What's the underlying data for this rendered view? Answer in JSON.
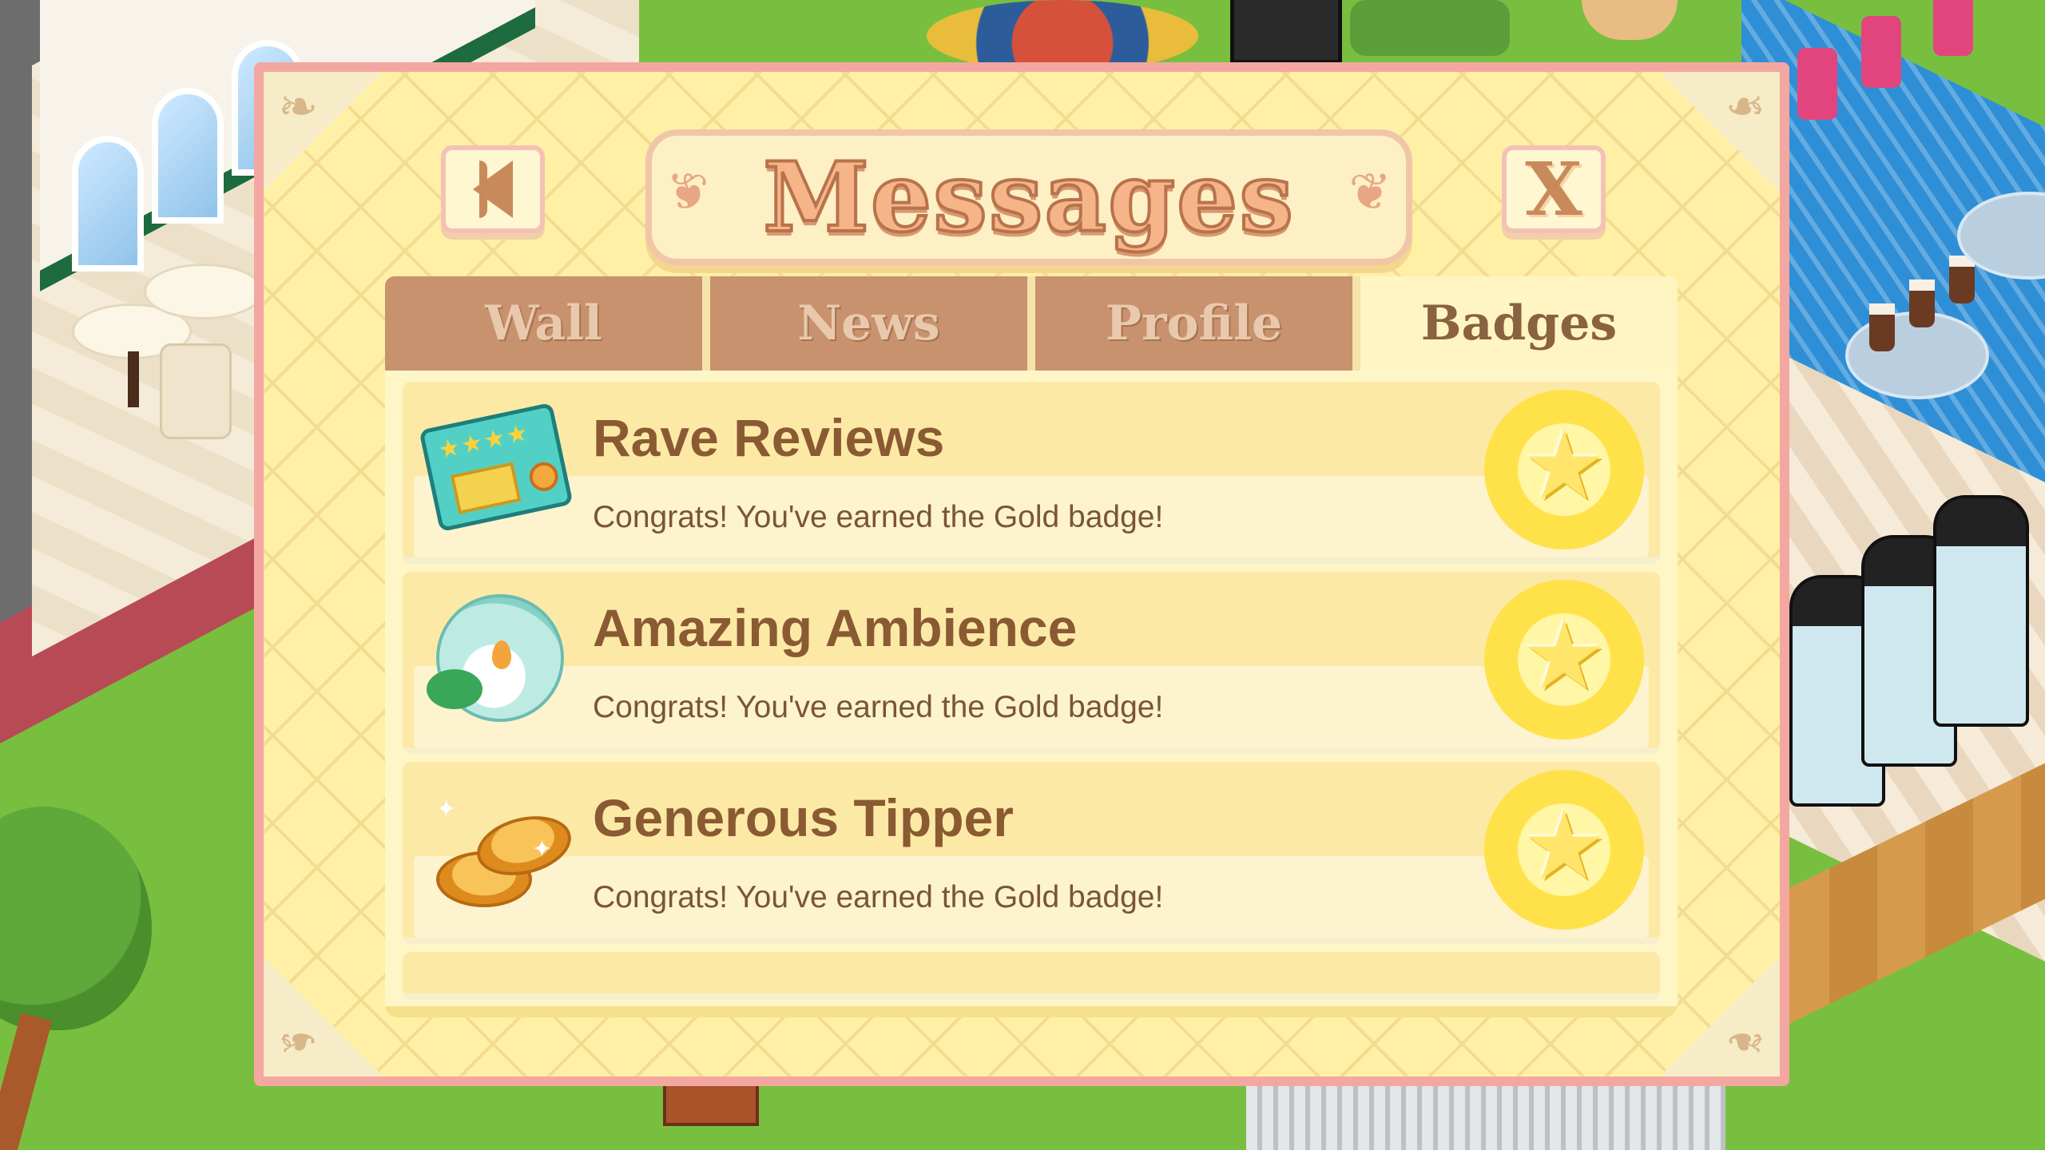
{
  "dialog": {
    "title": "Messages",
    "back_icon": "back-arrow-icon",
    "close_label": "X"
  },
  "tabs": [
    {
      "label": "Wall",
      "active": false
    },
    {
      "label": "News",
      "active": false
    },
    {
      "label": "Profile",
      "active": false
    },
    {
      "label": "Badges",
      "active": true
    }
  ],
  "badges": [
    {
      "title": "Rave Reviews",
      "description": "Congrats! You've earned the Gold badge!",
      "icon": "review-card-icon",
      "level": "Gold"
    },
    {
      "title": "Amazing Ambience",
      "description": "Congrats! You've earned the Gold badge!",
      "icon": "candle-bowl-icon",
      "level": "Gold"
    },
    {
      "title": "Generous Tipper",
      "description": "Congrats! You've earned the Gold badge!",
      "icon": "coins-icon",
      "level": "Gold"
    }
  ],
  "colors": {
    "panel_yellow": "#fff0a6",
    "border_pink": "#f4a7a0",
    "tab_brown": "#c8926e",
    "title_orange": "#f6b589",
    "text_brown": "#8a5a33",
    "badge_gold": "#ffe24a"
  }
}
